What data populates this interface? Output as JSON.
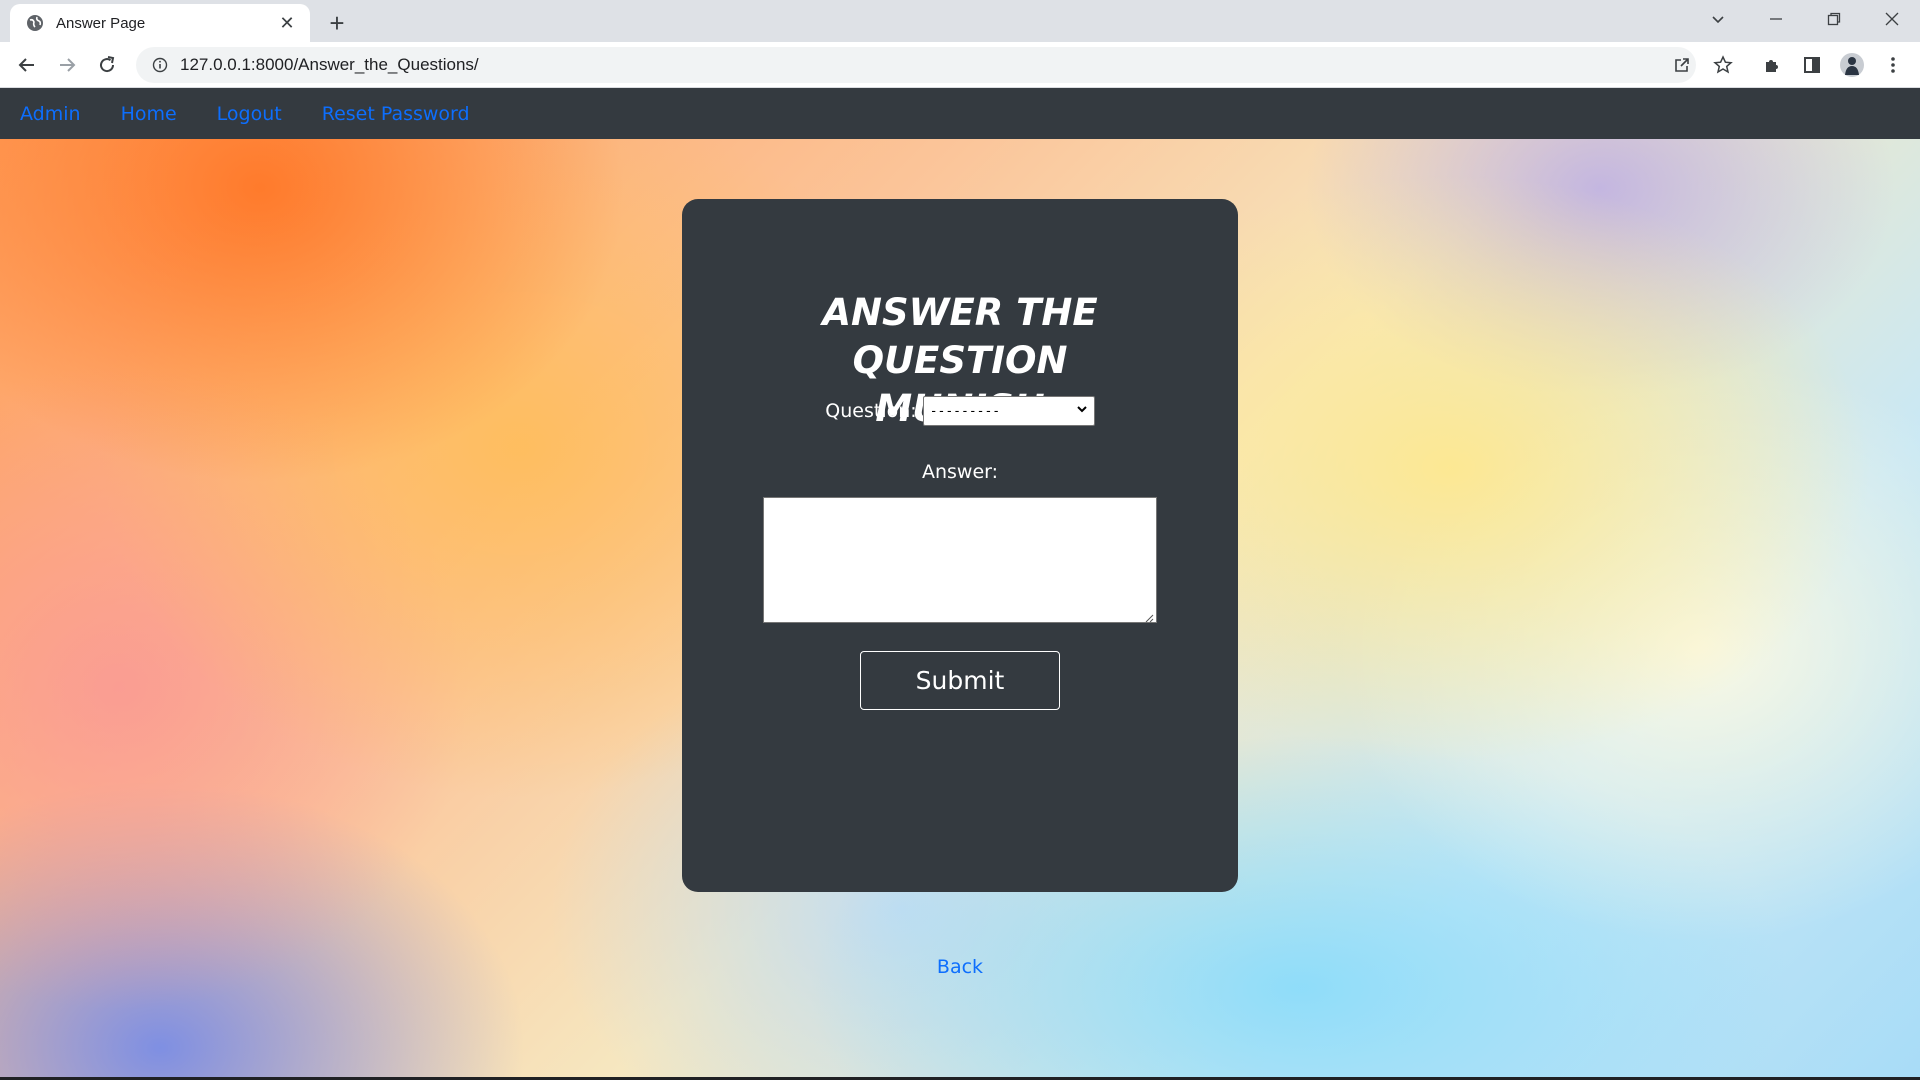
{
  "browser": {
    "tab_title": "Answer Page",
    "url": "127.0.0.1:8000/Answer_the_Questions/"
  },
  "navbar": {
    "links": [
      "Admin",
      "Home",
      "Logout",
      "Reset Password"
    ]
  },
  "form": {
    "title": "ANSWER THE QUESTION MUNISH",
    "question_label": "Question:",
    "question_selected": "---------",
    "answer_label": "Answer:",
    "answer_value": "",
    "submit_label": "Submit"
  },
  "back_label": "Back",
  "colors": {
    "navbar_bg": "#343a40",
    "card_bg": "#343a40",
    "link": "#0d6efd"
  }
}
